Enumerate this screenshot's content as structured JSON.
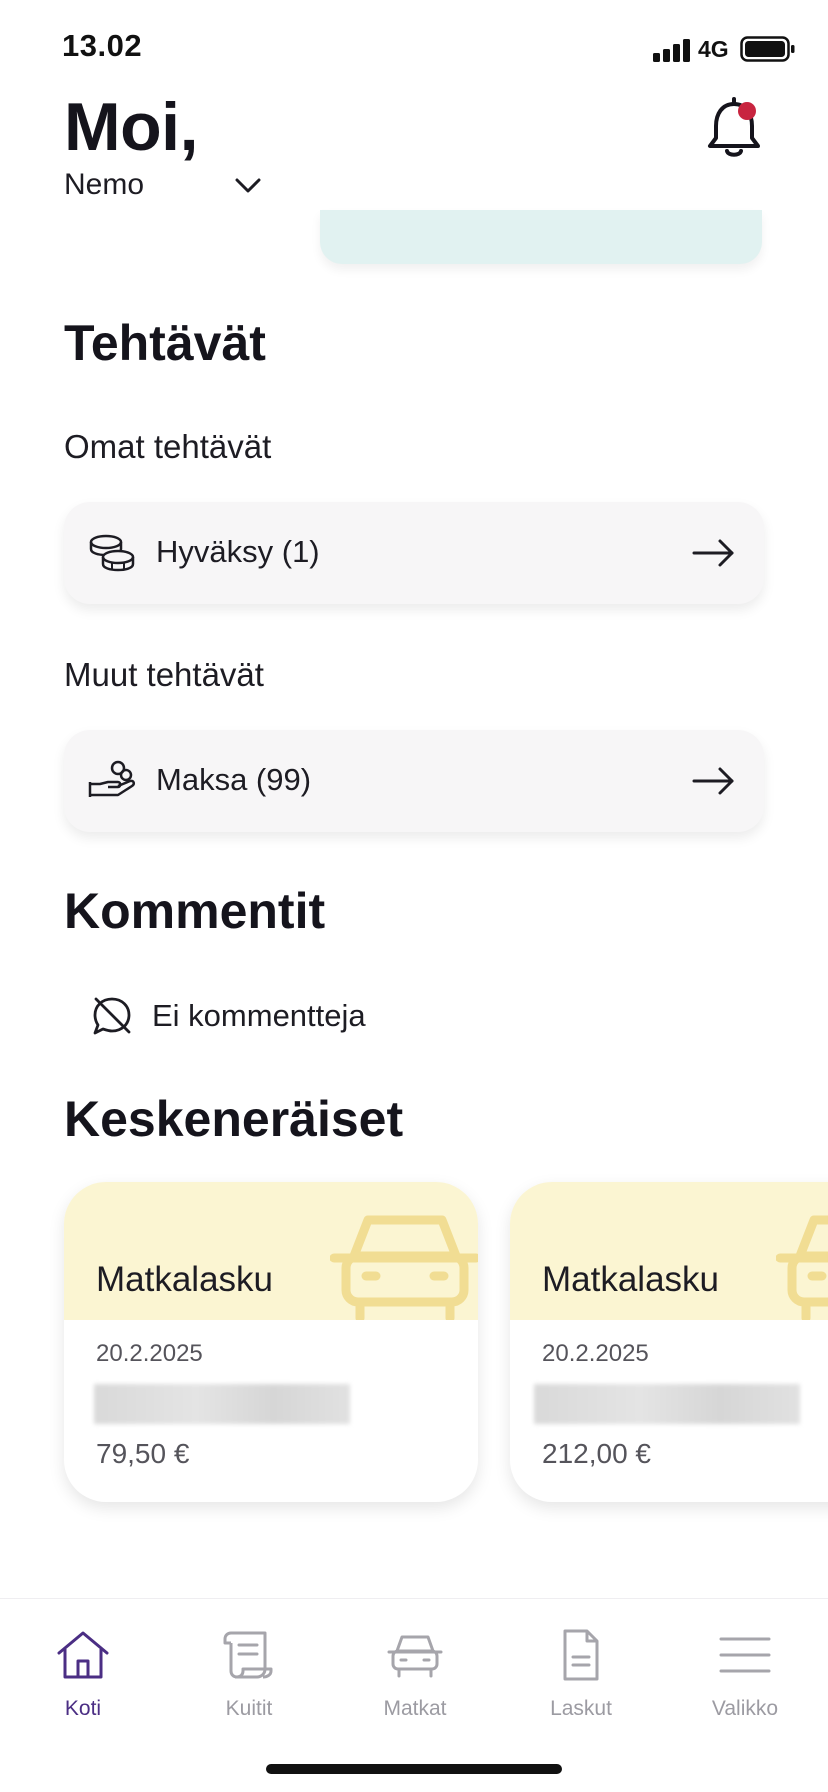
{
  "status_bar": {
    "time": "13.02",
    "network": "4G",
    "icons": [
      "signal-icon",
      "battery-icon"
    ]
  },
  "header": {
    "greeting": "Moi,",
    "user_name": "Nemo",
    "icons": [
      "chevron-down-icon",
      "bell-icon"
    ],
    "notification_dot_color": "#c8243f"
  },
  "tasks": {
    "title": "Tehtävät",
    "own": {
      "title": "Omat tehtävät",
      "items": [
        {
          "label": "Hyväksy (1)",
          "icon": "coins-icon"
        }
      ]
    },
    "other": {
      "title": "Muut tehtävät",
      "items": [
        {
          "label": "Maksa (99)",
          "icon": "hand-coins-icon"
        }
      ]
    }
  },
  "comments": {
    "title": "Kommentit",
    "empty_label": "Ei kommentteja",
    "icon": "no-comments-icon"
  },
  "drafts": {
    "title": "Keskeneräiset",
    "header_color": "#fbf5d2",
    "items": [
      {
        "title": "Matkalasku",
        "date": "20.2.2025",
        "amount": "79,50 €",
        "icon": "car-icon"
      },
      {
        "title": "Matkalasku",
        "date": "20.2.2025",
        "amount": "212,00 €",
        "icon": "car-icon"
      }
    ]
  },
  "bottom_nav": {
    "active_color": "#4b2e84",
    "items": [
      {
        "label": "Koti",
        "icon": "home-icon",
        "active": true
      },
      {
        "label": "Kuitit",
        "icon": "receipt-icon",
        "active": false
      },
      {
        "label": "Matkat",
        "icon": "car-icon",
        "active": false
      },
      {
        "label": "Laskut",
        "icon": "document-icon",
        "active": false
      },
      {
        "label": "Valikko",
        "icon": "menu-icon",
        "active": false
      }
    ]
  }
}
